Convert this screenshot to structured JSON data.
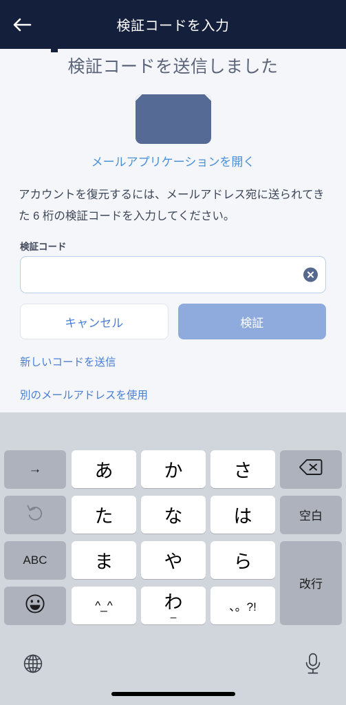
{
  "header": {
    "title": "検証コードを入力",
    "back_icon": "arrow-left-icon",
    "background_color": "#141f3c"
  },
  "content": {
    "heading": "検証コードを送信しました",
    "envelope_icon": "envelope-icon",
    "envelope_color": "#566a96",
    "mail_app_link": "メールアプリケーションを開く",
    "description": "アカウントを復元するには、メールアドレス宛に送られてきた 6 桁の検証コードを入力してください。",
    "field_label": "検証コード",
    "input_value": "",
    "input_placeholder": "",
    "clear_icon": "clear-circle-icon",
    "cancel_button": "キャンセル",
    "verify_button": "検証",
    "verify_button_color": "#8fabdd",
    "link_color": "#4a7fd4",
    "resend_link": "新しいコードを送信",
    "other_email_link": "別のメールアドレスを使用"
  },
  "keyboard": {
    "background_color": "#d1d5dc",
    "function_key_color": "#aeb2bc",
    "rows": [
      [
        {
          "label": "→",
          "type": "fn",
          "name": "key-next-candidate"
        },
        {
          "label": "あ",
          "type": "char",
          "name": "key-a"
        },
        {
          "label": "か",
          "type": "char",
          "name": "key-ka"
        },
        {
          "label": "さ",
          "type": "char",
          "name": "key-sa"
        },
        {
          "label": "",
          "type": "fn",
          "name": "key-backspace",
          "icon": "backspace-icon"
        }
      ],
      [
        {
          "label": "",
          "type": "fn-dim",
          "name": "key-undo",
          "icon": "undo-icon"
        },
        {
          "label": "た",
          "type": "char",
          "name": "key-ta"
        },
        {
          "label": "な",
          "type": "char",
          "name": "key-na"
        },
        {
          "label": "は",
          "type": "char",
          "name": "key-ha"
        },
        {
          "label": "空白",
          "type": "fn",
          "name": "key-space"
        }
      ],
      [
        {
          "label": "ABC",
          "type": "fn",
          "name": "key-abc"
        },
        {
          "label": "ま",
          "type": "char",
          "name": "key-ma"
        },
        {
          "label": "や",
          "type": "char",
          "name": "key-ya"
        },
        {
          "label": "ら",
          "type": "char",
          "name": "key-ra"
        },
        {
          "label": "改行",
          "type": "fn",
          "name": "key-return"
        }
      ],
      [
        {
          "label": "",
          "type": "fn",
          "name": "key-emoji",
          "icon": "emoji-icon"
        },
        {
          "label": "^_^",
          "type": "char",
          "name": "key-kaomoji"
        },
        {
          "label": "わ",
          "sub": "_",
          "type": "char",
          "name": "key-wa"
        },
        {
          "label": "、。?!",
          "type": "char",
          "name": "key-punctuation"
        }
      ]
    ],
    "globe_icon": "globe-icon",
    "mic_icon": "microphone-icon"
  }
}
